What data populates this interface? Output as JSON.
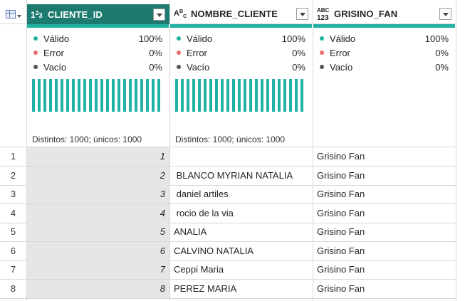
{
  "colors": {
    "accent": "#21b2a3",
    "selected_header": "#1d7a6f",
    "valid_dot": "#21b2a3",
    "error_dot": "#e86a6a",
    "empty_dot": "#555555"
  },
  "columns": [
    {
      "type_top": "1²",
      "type_bottom": "3",
      "type_text": "1²3",
      "name": "CLIENTE_ID",
      "icon": "whole-number-type-icon",
      "stats": [
        {
          "label": "Válido",
          "value": "100%"
        },
        {
          "label": "Error",
          "value": "0%"
        },
        {
          "label": "Vacío",
          "value": "0%"
        }
      ],
      "distinct": "Distintos: 1000; únicos: 1000"
    },
    {
      "type_text": "ABC",
      "name": "NOMBRE_CLIENTE",
      "icon": "text-type-icon",
      "stats": [
        {
          "label": "Válido",
          "value": "100%"
        },
        {
          "label": "Error",
          "value": "0%"
        },
        {
          "label": "Vacío",
          "value": "0%"
        }
      ],
      "distinct": "Distintos: 1000; únicos: 1000"
    },
    {
      "type_text": "ABC 123",
      "name": "GRISINO_FAN",
      "icon": "any-type-icon",
      "stats": [
        {
          "label": "Válido",
          "value": "100%"
        },
        {
          "label": "Error",
          "value": "0%"
        },
        {
          "label": "Vacío",
          "value": "0%"
        }
      ],
      "distinct": ""
    }
  ],
  "rows": [
    {
      "n": "1",
      "id": "1",
      "name": "",
      "fan": "Grisino Fan"
    },
    {
      "n": "2",
      "id": "2",
      "name": " BLANCO MYRIAN NATALIA",
      "fan": "Grisino Fan"
    },
    {
      "n": "3",
      "id": "3",
      "name": " daniel artiles",
      "fan": "Grisino Fan"
    },
    {
      "n": "4",
      "id": "4",
      "name": " rocio de la via",
      "fan": "Grisino Fan"
    },
    {
      "n": "5",
      "id": "5",
      "name": "ANALIA",
      "fan": "Grisino Fan"
    },
    {
      "n": "6",
      "id": "6",
      "name": "CALVINO NATALIA",
      "fan": "Grisino Fan"
    },
    {
      "n": "7",
      "id": "7",
      "name": "Ceppi Maria",
      "fan": "Grisino Fan"
    },
    {
      "n": "8",
      "id": "8",
      "name": "PEREZ MARIA",
      "fan": "Grisino Fan"
    }
  ]
}
